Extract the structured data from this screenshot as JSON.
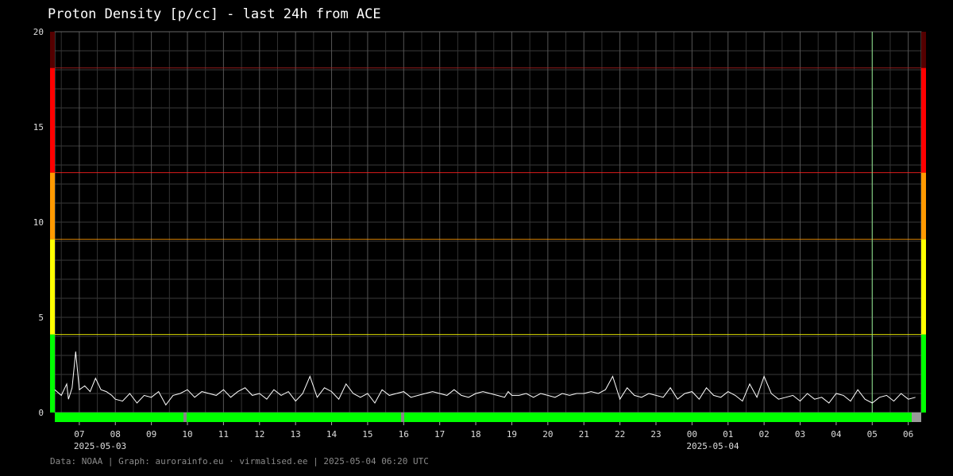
{
  "title": "Proton Density [p/cc] - last 24h from ACE",
  "footer": "Data: NOAA | Graph: aurorainfo.eu · virmalised.ee | 2025-05-04 06:20 UTC",
  "chart_data": {
    "type": "line",
    "title": "Proton Density [p/cc] - last 24h from ACE",
    "ylim": [
      0,
      20
    ],
    "y_ticks": [
      0,
      5,
      10,
      15,
      20
    ],
    "x_range_hours": [
      -0.68,
      23.36
    ],
    "x_ticks": [
      "07",
      "08",
      "09",
      "10",
      "11",
      "12",
      "13",
      "14",
      "15",
      "16",
      "17",
      "18",
      "19",
      "20",
      "21",
      "22",
      "23",
      "00",
      "01",
      "02",
      "03",
      "04",
      "05",
      "06"
    ],
    "date_labels": [
      {
        "tick": "07",
        "label": "2025-05-03"
      },
      {
        "tick": "00",
        "label": "2025-05-04"
      }
    ],
    "grid": true,
    "current_time_marker": "05:00",
    "threshold_lines": [
      {
        "value": 4.1,
        "color": "#ffff00"
      },
      {
        "value": 9.1,
        "color": "#ff9900"
      },
      {
        "value": 12.6,
        "color": "#ff2222"
      },
      {
        "value": 18.1,
        "color": "#aa2222"
      }
    ],
    "scale_bands": [
      {
        "from": 0,
        "to": 4.1,
        "color": "#00ff00"
      },
      {
        "from": 4.1,
        "to": 9.1,
        "color": "#ffff00"
      },
      {
        "from": 9.1,
        "to": 12.6,
        "color": "#ff9900"
      },
      {
        "from": 12.6,
        "to": 18.1,
        "color": "#ff0000"
      },
      {
        "from": 18.1,
        "to": 20,
        "color": "#550000"
      }
    ],
    "quality_bar": {
      "color_ok": "#00ff00",
      "color_missing": "#999999"
    },
    "series": [
      {
        "color": "#ffffff",
        "x_hours": [
          -0.68,
          -0.5,
          -0.35,
          -0.3,
          -0.2,
          -0.1,
          0,
          0.15,
          0.3,
          0.45,
          0.6,
          0.75,
          0.9,
          1.0,
          1.2,
          1.4,
          1.6,
          1.8,
          2.0,
          2.2,
          2.4,
          2.6,
          2.8,
          3.0,
          3.2,
          3.4,
          3.6,
          3.8,
          4.0,
          4.2,
          4.4,
          4.6,
          4.8,
          5.0,
          5.2,
          5.4,
          5.6,
          5.8,
          6.0,
          6.2,
          6.4,
          6.6,
          6.8,
          7.0,
          7.2,
          7.4,
          7.6,
          7.8,
          8.0,
          8.2,
          8.4,
          8.6,
          8.8,
          9.0,
          9.2,
          9.4,
          9.6,
          9.8,
          10.0,
          10.2,
          10.4,
          10.6,
          10.8,
          11.0,
          11.2,
          11.4,
          11.6,
          11.8,
          11.9,
          12.0,
          12.2,
          12.4,
          12.6,
          12.8,
          13.0,
          13.2,
          13.4,
          13.6,
          13.8,
          14.0,
          14.2,
          14.4,
          14.6,
          14.8,
          15.0,
          15.2,
          15.4,
          15.6,
          15.8,
          16.0,
          16.2,
          16.4,
          16.6,
          16.8,
          17.0,
          17.2,
          17.4,
          17.6,
          17.8,
          18.0,
          18.2,
          18.4,
          18.6,
          18.8,
          19.0,
          19.2,
          19.4,
          19.6,
          19.8,
          20.0,
          20.2,
          20.4,
          20.6,
          20.8,
          21.0,
          21.2,
          21.4,
          21.6,
          21.8,
          22.0,
          22.2,
          22.4,
          22.6,
          22.8,
          23.0,
          23.2
        ],
        "values": [
          1.2,
          0.9,
          1.5,
          0.7,
          1.3,
          3.2,
          1.2,
          1.4,
          1.1,
          1.8,
          1.2,
          1.1,
          0.9,
          0.7,
          0.6,
          1.0,
          0.5,
          0.9,
          0.8,
          1.1,
          0.4,
          0.9,
          1.0,
          1.2,
          0.8,
          1.1,
          1.0,
          0.9,
          1.2,
          0.8,
          1.1,
          1.3,
          0.9,
          1.0,
          0.7,
          1.2,
          0.9,
          1.1,
          0.6,
          1.0,
          1.9,
          0.8,
          1.3,
          1.1,
          0.7,
          1.5,
          1.0,
          0.8,
          1.0,
          0.5,
          1.2,
          0.9,
          1.0,
          1.1,
          0.8,
          0.9,
          1.0,
          1.1,
          1.0,
          0.9,
          1.2,
          0.9,
          0.8,
          1.0,
          1.1,
          1.0,
          0.9,
          0.8,
          1.1,
          0.9,
          0.9,
          1.0,
          0.8,
          1.0,
          0.9,
          0.8,
          1.0,
          0.9,
          1.0,
          1.0,
          1.1,
          1.0,
          1.2,
          1.9,
          0.7,
          1.3,
          0.9,
          0.8,
          1.0,
          0.9,
          0.8,
          1.3,
          0.7,
          1.0,
          1.1,
          0.7,
          1.3,
          0.9,
          0.8,
          1.1,
          0.9,
          0.6,
          1.5,
          0.8,
          1.9,
          1.0,
          0.7,
          0.8,
          0.9,
          0.6,
          1.0,
          0.7,
          0.8,
          0.5,
          1.0,
          0.9,
          0.6,
          1.2,
          0.7,
          0.5,
          0.8,
          0.9,
          0.6,
          1.0,
          0.7,
          0.8,
          0.5,
          1.3,
          0.8,
          1.9,
          1.1
        ]
      }
    ]
  }
}
